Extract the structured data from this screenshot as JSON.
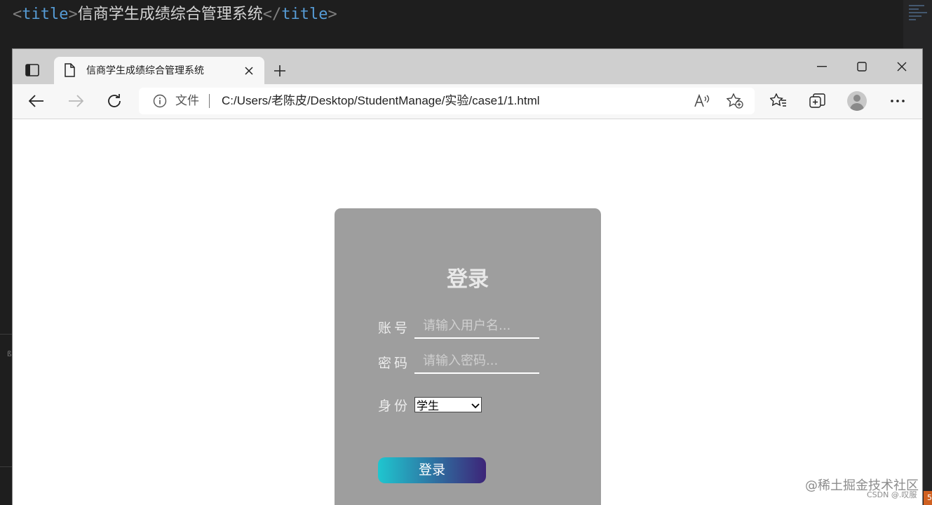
{
  "editor": {
    "lt": "<",
    "tag_open": "title",
    "gt": ">",
    "text": "信商学生成绩综合管理系统",
    "lt_close": "</",
    "tag_close": "title",
    "gt_close": ">",
    "side_glyph": "ß",
    "orange_tab": "5"
  },
  "browser": {
    "tab": {
      "title": "信商学生成绩综合管理系统"
    },
    "address": {
      "scheme_label": "文件",
      "url": "C:/Users/老陈皮/Desktop/StudentManage/实验/case1/1.html"
    }
  },
  "login": {
    "title": "登录",
    "account_label": "账号",
    "account_placeholder": "请输入用户名...",
    "password_label": "密码",
    "password_placeholder": "请输入密码...",
    "role_label": "身份",
    "role_selected": "学生",
    "submit_label": "登录"
  },
  "watermark": {
    "main": "@稀土掘金技术社区",
    "sub": "CSDN @.叹服"
  },
  "colors": {
    "card": "#9e9e9e",
    "button_gradient_start": "#1fc6cf",
    "button_gradient_end": "#3d2478",
    "editor_bg": "#1e1e1e"
  }
}
